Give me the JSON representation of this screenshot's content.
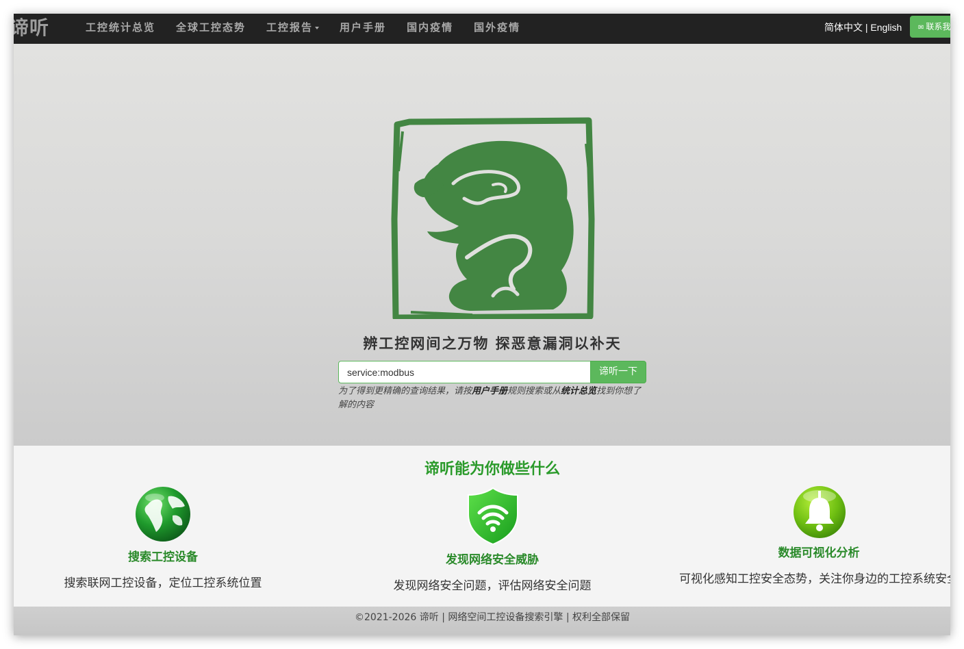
{
  "nav": {
    "brand": "谛听",
    "links": [
      {
        "label": "工控统计总览"
      },
      {
        "label": "全球工控态势"
      },
      {
        "label": "工控报告"
      },
      {
        "label": "用户手册"
      },
      {
        "label": "国内疫情"
      },
      {
        "label": "国外疫情"
      }
    ],
    "lang_zh": "简体中文",
    "lang_sep": " | ",
    "lang_en": "English",
    "contact_label": "联系我们",
    "contact_icon": "envelope-icon"
  },
  "hero": {
    "logo_icon": "beast-seal-logo",
    "slogan": "辨工控网间之万物 探恶意漏洞以补天",
    "search_value": "service:modbus",
    "search_button": "谛听一下",
    "hint_prefix": "为了得到更精确的查询结果，请按",
    "hint_link_manual": "用户手册",
    "hint_middle": "规则搜索或从",
    "hint_link_stats": "统计总览",
    "hint_suffix": "找到你想了解的内容"
  },
  "features": {
    "title": "谛听能为你做些什么",
    "items": [
      {
        "icon": "globe-icon",
        "title": "搜索工控设备",
        "desc": "搜索联网工控设备，定位工控系统位置"
      },
      {
        "icon": "wifi-shield-icon",
        "title": "发现网络安全威胁",
        "desc": "发现网络安全问题，评估网络安全问题"
      },
      {
        "icon": "bell-icon",
        "title": "数据可视化分析",
        "desc": "可视化感知工控安全态势，关注你身边的工控系统安全"
      }
    ]
  },
  "footer": {
    "text": "©2021-2026 谛听 | 网络空间工控设备搜索引擎 | 权利全部保留"
  },
  "colors": {
    "brand_green": "#5cb85c",
    "logo_green": "#438643",
    "heading_green": "#2a9a2a",
    "navbar": "#222222"
  }
}
